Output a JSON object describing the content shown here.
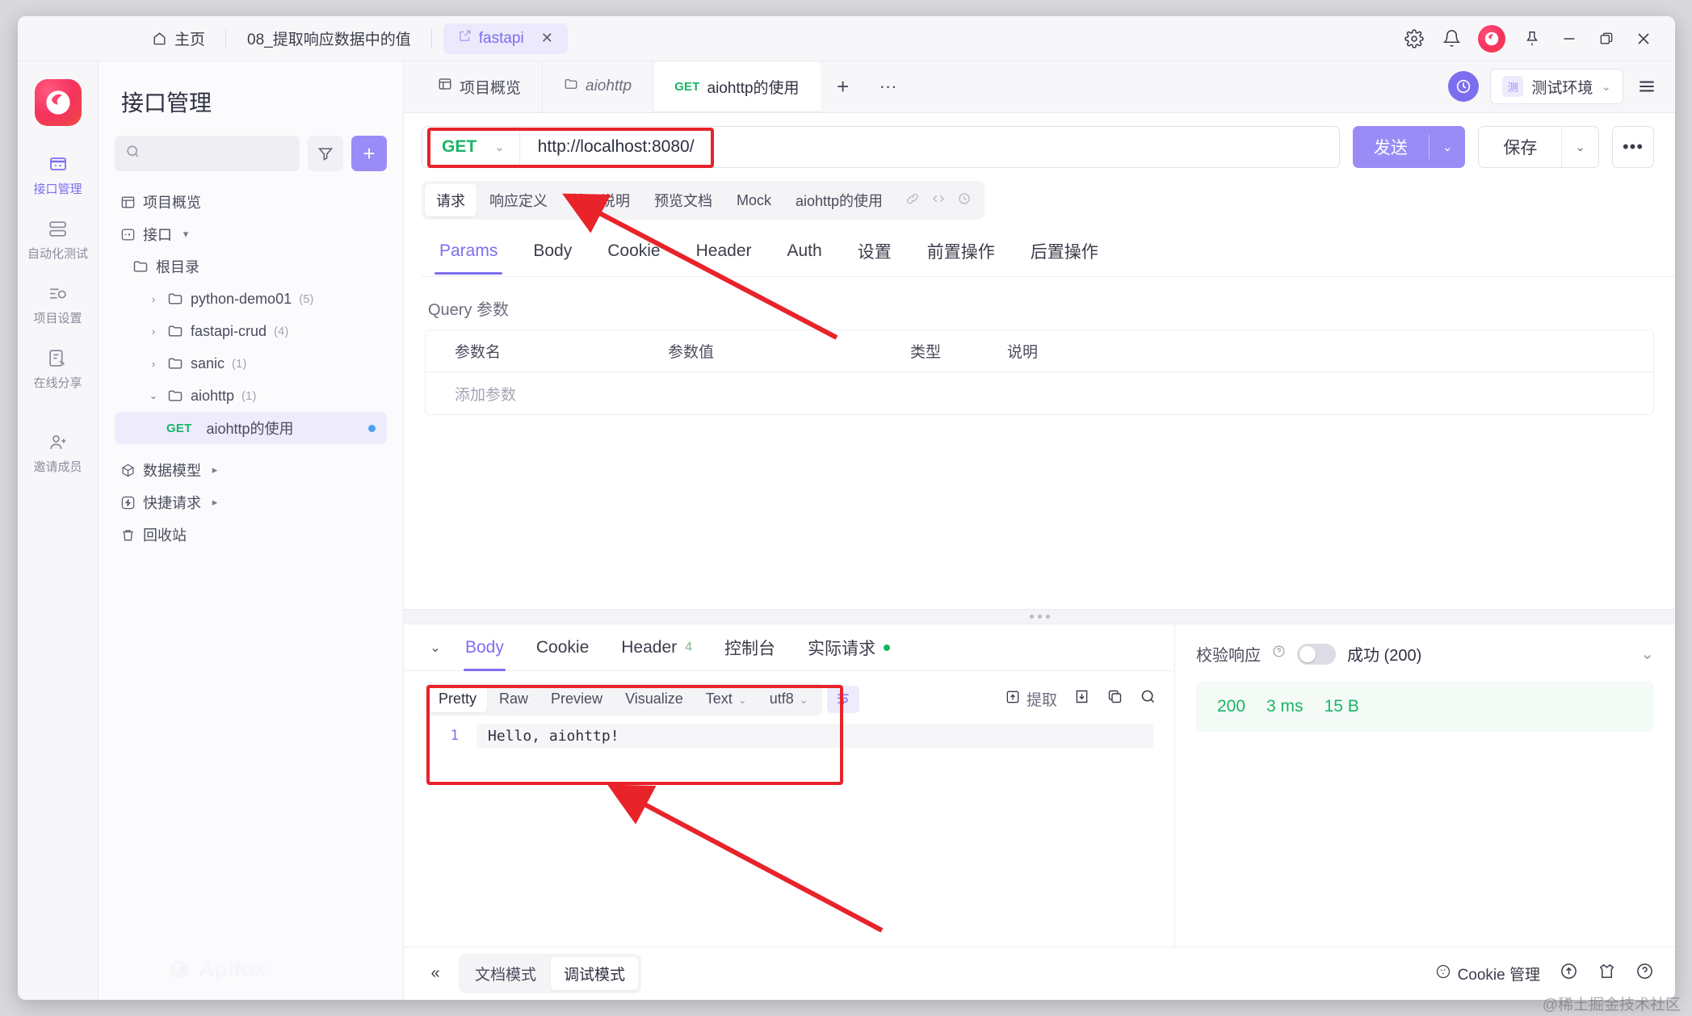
{
  "titlebar": {
    "home_label": "主页",
    "doc_label": "08_提取响应数据中的值",
    "project_tab": "fastapi",
    "close_x": "✕",
    "icons": {
      "settings": "gear-icon",
      "bell": "bell-icon",
      "pin": "pin-icon",
      "minimize": "—",
      "maximize": "maximize-icon",
      "close": "✕"
    }
  },
  "rail": {
    "items": [
      {
        "label": "接口管理",
        "active": true
      },
      {
        "label": "自动化测试",
        "active": false
      },
      {
        "label": "项目设置",
        "active": false
      },
      {
        "label": "在线分享",
        "active": false
      },
      {
        "label": "邀请成员",
        "active": false
      }
    ]
  },
  "tree": {
    "title": "接口管理",
    "search_placeholder": "",
    "search_value": "",
    "filter_icon": "filter-icon",
    "add_label": "+",
    "nodes": [
      {
        "label": "项目概览",
        "icon": "overview-icon",
        "count": "",
        "indent": 0,
        "type": "link"
      },
      {
        "label": "接口",
        "icon": "api-icon",
        "count": "",
        "indent": 0,
        "type": "group",
        "caret": "▾"
      },
      {
        "label": "根目录",
        "icon": "folder-icon",
        "count": "",
        "indent": 1,
        "type": "folder"
      },
      {
        "label": "python-demo01",
        "icon": "folder-icon",
        "count": "(5)",
        "indent": 2,
        "type": "folder",
        "caret": "›"
      },
      {
        "label": "fastapi-crud",
        "icon": "folder-icon",
        "count": "(4)",
        "indent": 2,
        "type": "folder",
        "caret": "›"
      },
      {
        "label": "sanic",
        "icon": "folder-icon",
        "count": "(1)",
        "indent": 2,
        "type": "folder",
        "caret": "›"
      },
      {
        "label": "aiohttp",
        "icon": "folder-icon",
        "count": "(1)",
        "indent": 2,
        "type": "folder",
        "caret": "⌄"
      }
    ],
    "api_item": {
      "method": "GET",
      "label": "aiohttp的使用",
      "dot": true
    },
    "footer_nodes": [
      {
        "label": "数据模型",
        "icon": "model-icon",
        "caret": "▸"
      },
      {
        "label": "快捷请求",
        "icon": "bolt-icon",
        "caret": "▸"
      },
      {
        "label": "回收站",
        "icon": "trash-icon",
        "caret": ""
      }
    ],
    "watermark": "Apifox"
  },
  "doc_tabs": {
    "tabs": [
      {
        "label": "项目概览",
        "icon": "overview-icon",
        "selected": false,
        "italic": false
      },
      {
        "label": "aiohttp",
        "icon": "folder-icon",
        "selected": false,
        "italic": true
      },
      {
        "label": "aiohttp的使用",
        "icon": "",
        "method": "GET",
        "selected": true,
        "italic": false
      }
    ],
    "add_label": "+",
    "more_label": "···",
    "sync_icon": "sync-icon",
    "env": {
      "badge": "测",
      "name": "测试环境",
      "caret": "⌄"
    },
    "menu_icon": "hamburger-icon"
  },
  "url_bar": {
    "method": "GET",
    "method_caret": "⌄",
    "url": "http://localhost:8080/",
    "send_label": "发送",
    "send_caret": "⌄",
    "save_label": "保存",
    "save_caret": "⌄",
    "more_label": "•••"
  },
  "pill_tabs": {
    "items": [
      {
        "label": "请求",
        "on": true
      },
      {
        "label": "响应定义",
        "on": false
      },
      {
        "label": "接口说明",
        "on": false
      },
      {
        "label": "预览文档",
        "on": false
      },
      {
        "label": "Mock",
        "on": false
      },
      {
        "label": "aiohttp的使用",
        "on": false
      }
    ],
    "icons": [
      "link-icon",
      "code-icon",
      "clock-icon"
    ]
  },
  "segments": {
    "items": [
      {
        "label": "Params",
        "on": true
      },
      {
        "label": "Body",
        "on": false
      },
      {
        "label": "Cookie",
        "on": false
      },
      {
        "label": "Header",
        "on": false
      },
      {
        "label": "Auth",
        "on": false
      },
      {
        "label": "设置",
        "on": false
      },
      {
        "label": "前置操作",
        "on": false
      },
      {
        "label": "后置操作",
        "on": false
      }
    ]
  },
  "params": {
    "section_label": "Query 参数",
    "headers": [
      "参数名",
      "参数值",
      "类型",
      "说明"
    ],
    "empty_row": "添加参数"
  },
  "response": {
    "tabs": [
      {
        "label": "Body",
        "on": true,
        "badge": "",
        "dot": false
      },
      {
        "label": "Cookie",
        "on": false,
        "badge": "",
        "dot": false
      },
      {
        "label": "Header",
        "on": false,
        "badge": "4",
        "dot": false
      },
      {
        "label": "控制台",
        "on": false,
        "badge": "",
        "dot": false
      },
      {
        "label": "实际请求",
        "on": false,
        "badge": "",
        "dot": true
      }
    ],
    "collapse_caret": "⌄",
    "viewer_pills": [
      {
        "label": "Pretty",
        "on": true,
        "caret": ""
      },
      {
        "label": "Raw",
        "on": false,
        "caret": ""
      },
      {
        "label": "Preview",
        "on": false,
        "caret": ""
      },
      {
        "label": "Visualize",
        "on": false,
        "caret": ""
      },
      {
        "label": "Text",
        "on": false,
        "caret": "⌄"
      },
      {
        "label": "utf8",
        "on": false,
        "caret": "⌄"
      }
    ],
    "wrap_icon": "wrap-icon",
    "tools": {
      "extract_label": "提取",
      "extract_icon": "extract-icon",
      "download_icon": "download-icon",
      "copy_icon": "copy-icon",
      "search_icon": "search-icon"
    },
    "code": {
      "line_no": "1",
      "text": "Hello, aiohttp!"
    },
    "right": {
      "verify_label": "校验响应",
      "help_icon": "help-icon",
      "toggle_on": false,
      "status_text": "成功 (200)",
      "chev": "⌄",
      "status_code": "200",
      "time": "3 ms",
      "size": "15 B"
    }
  },
  "bottom": {
    "collapse_icon": "«",
    "modes": [
      {
        "label": "文档模式",
        "on": false
      },
      {
        "label": "调试模式",
        "on": true
      }
    ],
    "cookie_label": "Cookie 管理",
    "cookie_icon": "cookie-icon",
    "icons": [
      "upload-circle-icon",
      "shirt-icon",
      "help-circle-icon"
    ]
  },
  "watermark": "@稀土掘金技术社区",
  "colors": {
    "accent": "#7d6ef0",
    "send_button": "#9a8cf7",
    "method_green": "#18b566",
    "annotation_red": "#e8232a",
    "logo_red": "#f5335f"
  }
}
